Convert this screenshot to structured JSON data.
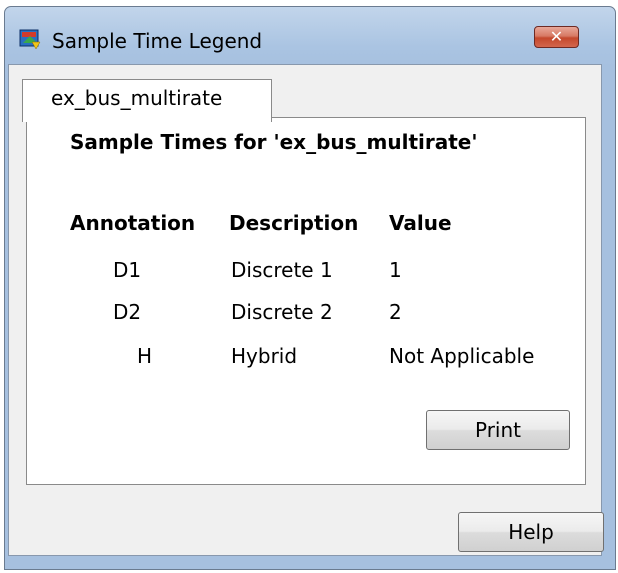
{
  "window": {
    "title": "Sample Time Legend",
    "close_label": "✕"
  },
  "tabs": [
    {
      "label": "ex_bus_multirate",
      "active": true
    }
  ],
  "panel": {
    "heading": "Sample Times for 'ex_bus_multirate'",
    "columns": [
      "Annotation",
      "Description",
      "Value"
    ],
    "rows": [
      {
        "annotation": "D1",
        "description": "Discrete 1",
        "value": "1"
      },
      {
        "annotation": "D2",
        "description": "Discrete 2",
        "value": "2"
      },
      {
        "annotation": "H",
        "description": "Hybrid",
        "value": "Not Applicable"
      }
    ],
    "print_label": "Print"
  },
  "footer": {
    "help_label": "Help"
  },
  "colors": {
    "titlebar": "#aac4e2",
    "close_button": "#c4482c",
    "panel_bg": "#ffffff",
    "client_bg": "#f0f0f0"
  },
  "icons": {
    "app": "simulink-block-icon",
    "close": "close-icon"
  }
}
